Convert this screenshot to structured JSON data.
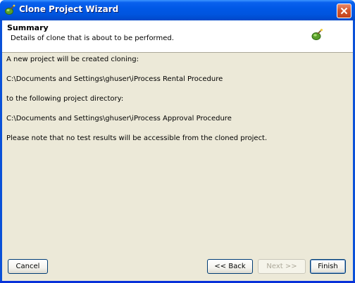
{
  "window": {
    "title": "Clone Project Wizard"
  },
  "header": {
    "title": "Summary",
    "description": "Details of clone that is about to be performed."
  },
  "body": {
    "line1": "A new project will be created cloning:",
    "source_path": "C:\\Documents and Settings\\ghuser\\iProcess Rental Procedure",
    "line3": "to the following project directory:",
    "target_path": "C:\\Documents and Settings\\ghuser\\iProcess Approval Procedure",
    "note": "Please note that no test results will be accessible from the cloned project."
  },
  "buttons": {
    "cancel": "Cancel",
    "back": "<< Back",
    "next": "Next >>",
    "finish": "Finish"
  },
  "icons": {
    "title_icon": "wizard-app-icon",
    "header_icon": "wizard-app-icon",
    "close": "close-icon"
  },
  "colors": {
    "titlebar": "#0055df",
    "dialog_background": "#ece9d8",
    "header_background": "#ffffff"
  }
}
